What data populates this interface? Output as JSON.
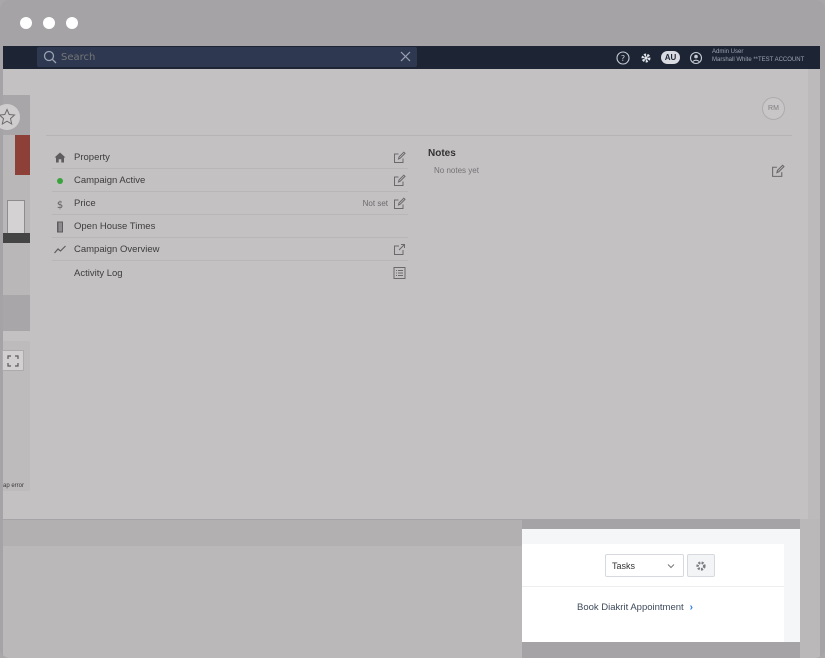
{
  "topnav": {
    "search_placeholder": "Search",
    "badge": "AU",
    "user_name": "Admin User",
    "account": "Marshall White **TEST ACCOUNT"
  },
  "listing": {
    "map_error": "ap error",
    "avatar_initials": "RM"
  },
  "details": {
    "rows": [
      {
        "label": "Property",
        "icon": "home-icon",
        "action": "edit-icon"
      },
      {
        "label": "Campaign Active",
        "icon": "status-dot",
        "action": "edit-icon"
      },
      {
        "label": "Price",
        "icon": "dollar-icon",
        "value": "Not set",
        "action": "edit-icon"
      },
      {
        "label": "Open House Times",
        "icon": "door-icon"
      },
      {
        "label": "Campaign Overview",
        "icon": "trend-icon",
        "action": "external-link-icon"
      },
      {
        "label": "Activity Log",
        "action": "list-icon"
      }
    ]
  },
  "notes": {
    "title": "Notes",
    "empty": "No notes yet"
  },
  "tasks": {
    "select_value": "Tasks",
    "link_label": "Book Diakrit Appointment"
  },
  "colors": {
    "nav_bg": "#1d2535",
    "status_green": "#3aa33d",
    "link_blue": "#2c7be5"
  }
}
